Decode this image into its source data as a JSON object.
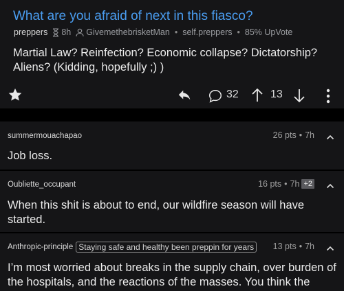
{
  "post": {
    "title": "What are you afraid of next in this fiasco?",
    "subreddit_short": "preppers",
    "age": "8h",
    "author": "GivemethebrisketMan",
    "domain": "self.preppers",
    "upvote_ratio": "85% UpVote",
    "body": "Martial Law? Reinfection? Economic collapse? Dictatorship? Aliens? (Kidding, hopefully ;) )",
    "comment_count": "32",
    "score": "13",
    "accent_color": "#4a9df0"
  },
  "icons": [
    "hourglass-icon",
    "user-icon",
    "star-icon",
    "reply-icon",
    "comment-icon",
    "upvote-arrow-icon",
    "downvote-arrow-icon",
    "more-vertical-icon",
    "chevron-up-icon"
  ],
  "comments": [
    {
      "author": "summermouachapao",
      "points": "26 pts",
      "age": "7h",
      "body": "Job loss."
    },
    {
      "author": "Oubliette_occupant",
      "points": "16 pts",
      "age": "7h",
      "edits": "+2",
      "body": "When this shit is about to end, our wildfire season will have started."
    },
    {
      "author": "Anthropic-principle",
      "flair": "Staying safe and healthy been preppin for years",
      "points": "13 pts",
      "age": "7h",
      "body": "I’m most worried about breaks in the supply chain, over burden of the hospitals, and the reactions of the masses. You think the"
    }
  ]
}
